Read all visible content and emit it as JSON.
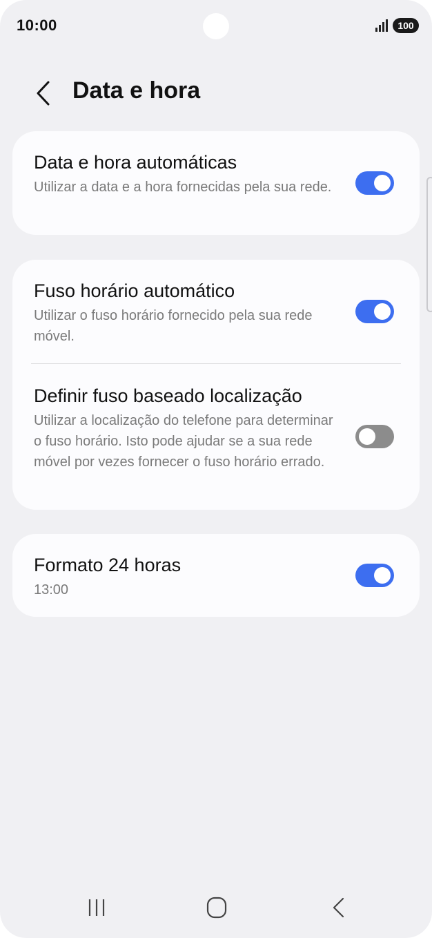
{
  "status_bar": {
    "time": "10:00",
    "battery": "100",
    "signal_icon": "signal-icon"
  },
  "header": {
    "title": "Data e hora",
    "back_icon": "chevron-left-icon"
  },
  "settings": {
    "auto_datetime": {
      "title": "Data e hora automáticas",
      "subtitle": "Utilizar a data e a hora fornecidas pela sua rede.",
      "enabled": true
    },
    "auto_timezone": {
      "title": "Fuso horário automático",
      "subtitle": "Utilizar o fuso horário fornecido pela sua rede móvel.",
      "enabled": true
    },
    "location_timezone": {
      "title": "Definir fuso baseado localização",
      "subtitle": "Utilizar a localização do telefone para determinar o fuso horário. Isto pode ajudar se a sua rede móvel por vezes fornecer o fuso horário errado.",
      "enabled": false
    },
    "format_24h": {
      "title": "Formato 24 horas",
      "subtitle": "13:00",
      "enabled": true
    }
  },
  "nav_bar": {
    "recents_icon": "recents-icon",
    "home_icon": "home-icon",
    "back_icon": "back-icon"
  },
  "colors": {
    "accent": "#3d6ef0",
    "toggle_off": "#8c8c8c",
    "background": "#f0f0f3",
    "card": "#fcfcfe"
  }
}
